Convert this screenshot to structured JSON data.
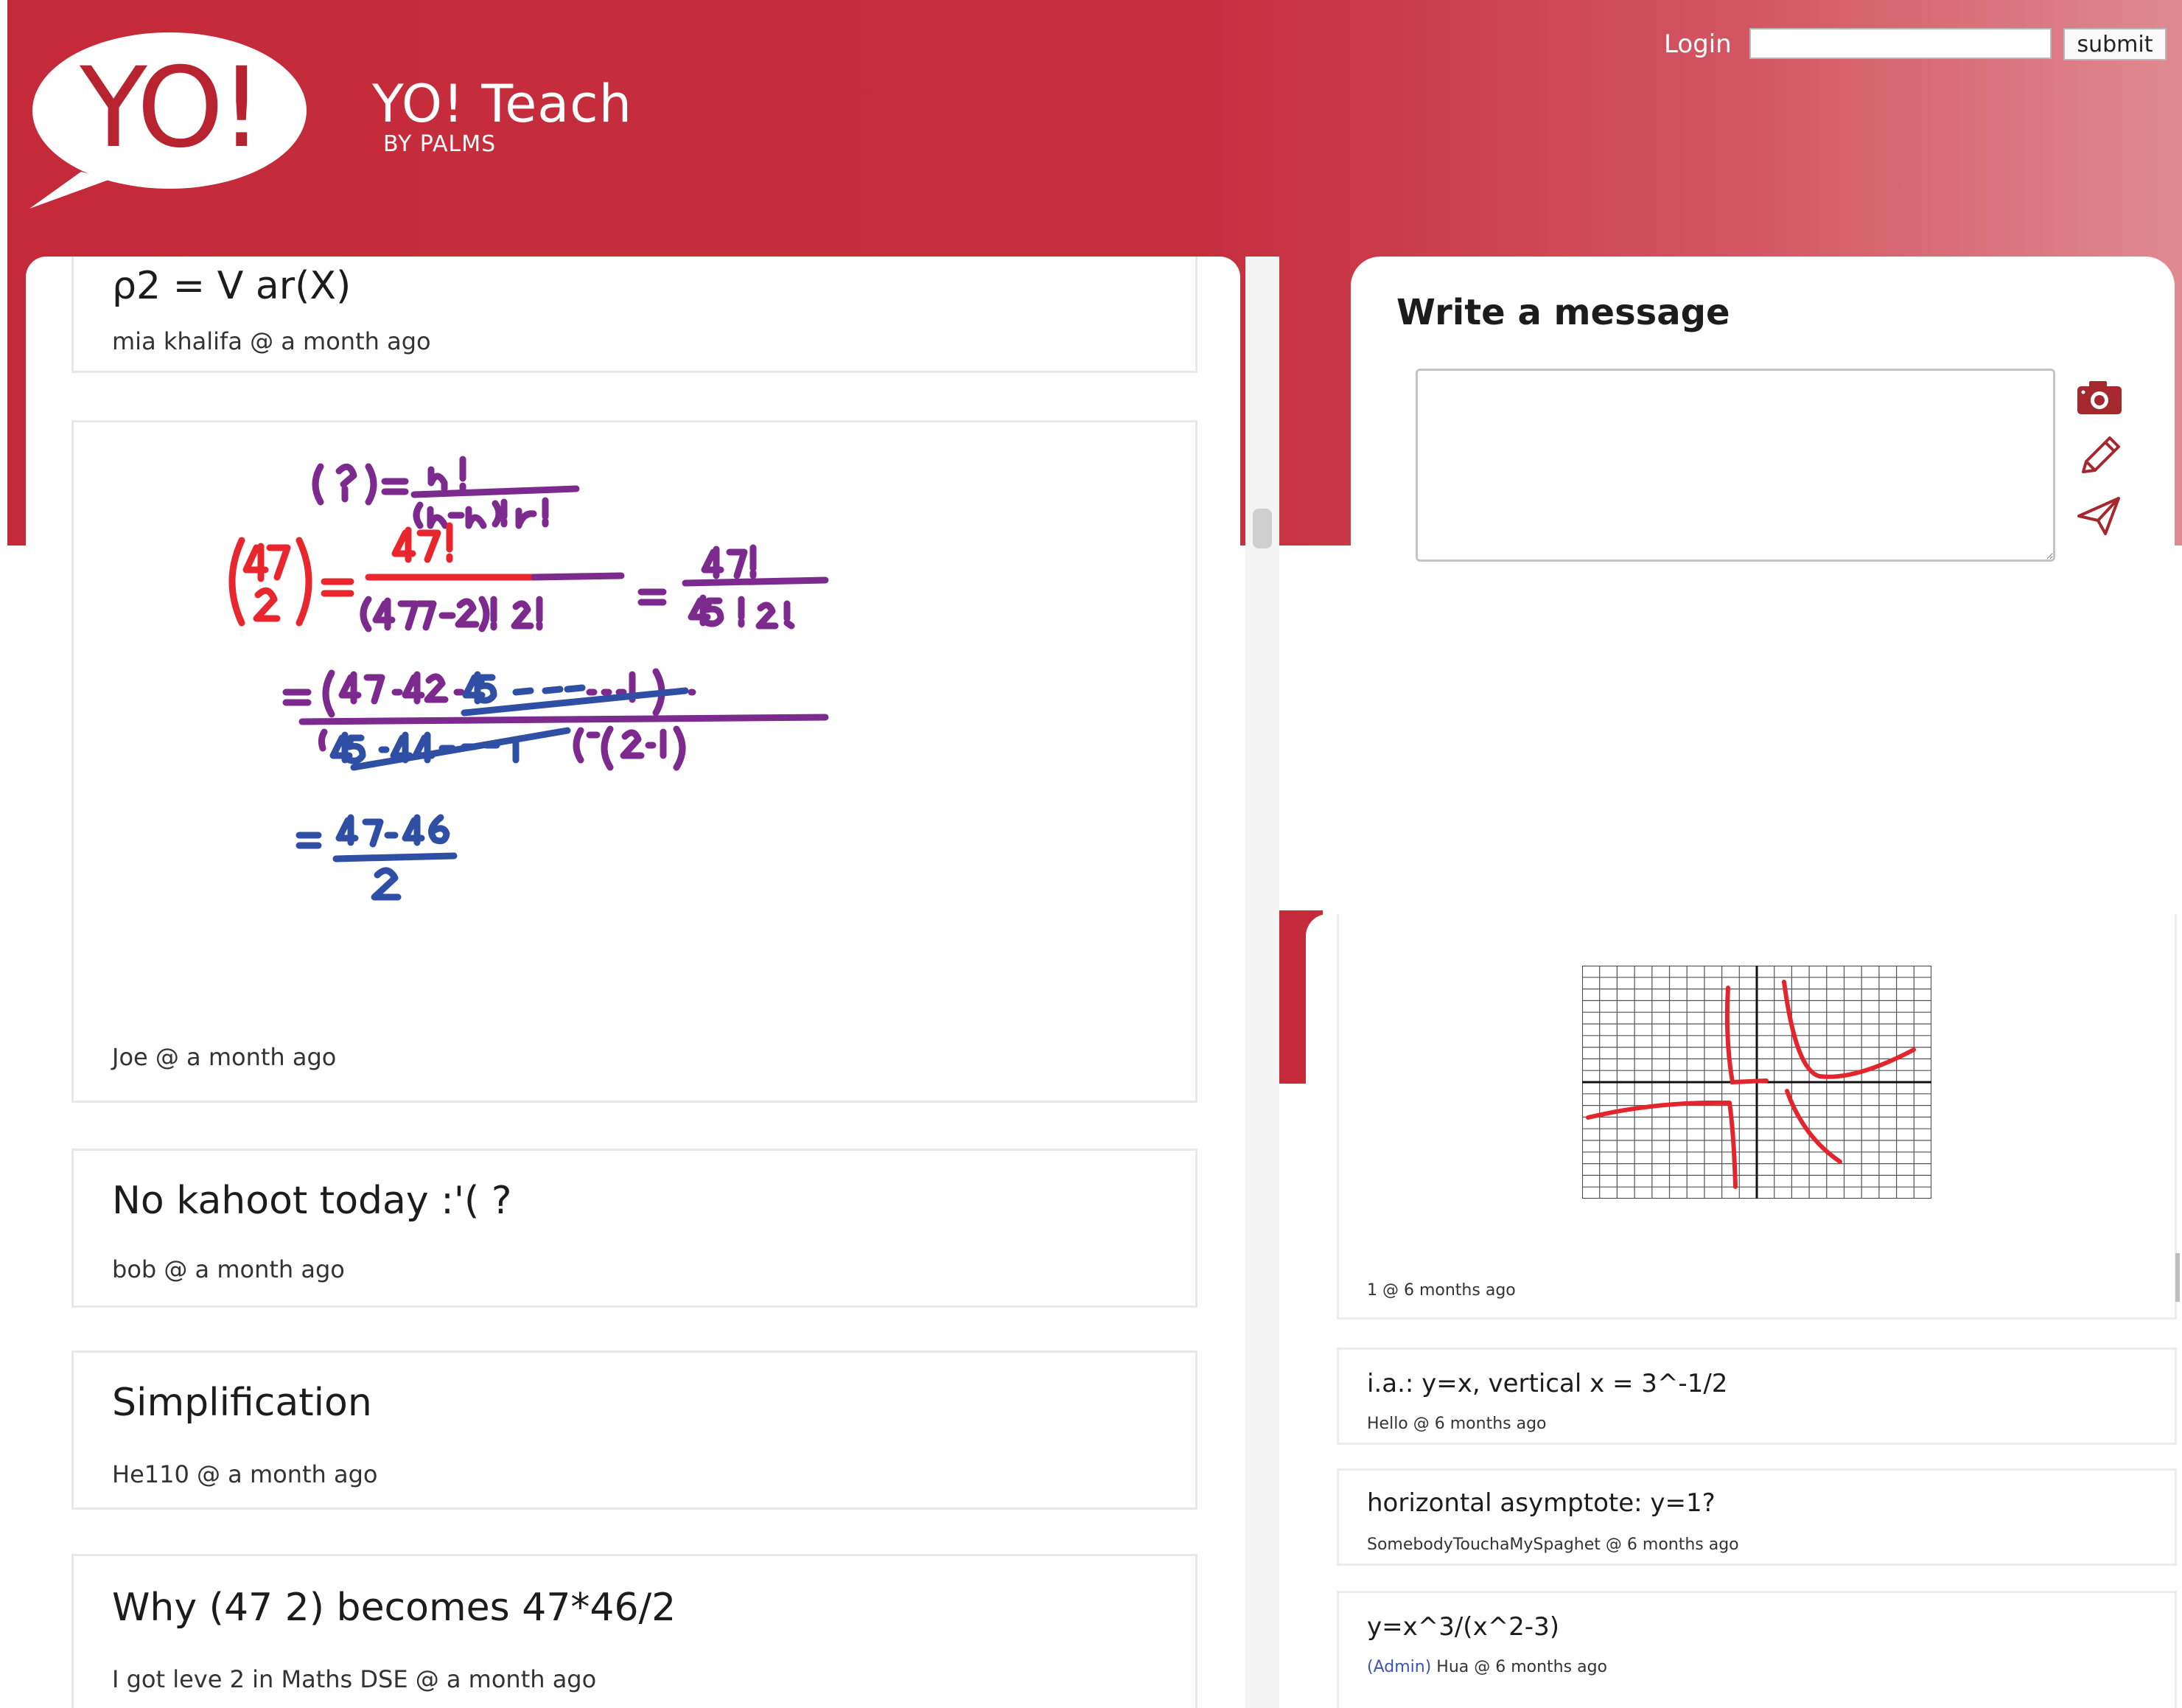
{
  "brand": {
    "logo_text": "YO!",
    "title": "YO! Teach",
    "subtitle": "BY PALMS"
  },
  "header": {
    "login_label": "Login",
    "login_value": "",
    "submit_label": "submit"
  },
  "feed": {
    "posts": [
      {
        "title": "ρ2 = V ar(X)",
        "meta": "mia khalifa @ a month ago"
      },
      {
        "title": "",
        "meta": "Joe @ a month ago",
        "image": "handwritten-combination-working"
      },
      {
        "title": "No kahoot today :'( ?",
        "meta": "bob @ a month ago"
      },
      {
        "title": "Simplification",
        "meta": "He110 @ a month ago"
      },
      {
        "title": "Why (47 2) becomes 47*46/2",
        "meta": "I got leve 2 in Maths DSE @ a month ago"
      }
    ]
  },
  "composer": {
    "heading": "Write a message",
    "text": "",
    "icons": [
      "camera-icon",
      "pencil-icon",
      "send-icon"
    ]
  },
  "right_feed": {
    "posts": [
      {
        "title": "",
        "meta": "1 @ 6 months ago",
        "image": "hyperbola-graph-sketch"
      },
      {
        "title": "i.a.: y=x, vertical x = 3^-1/2",
        "meta": "Hello @ 6 months ago"
      },
      {
        "title": "horizontal asymptote: y=1?",
        "meta": "SomebodyTouchaMySpaghet @ 6 months ago"
      },
      {
        "title": "y=x^3/(x^2-3)",
        "admin_tag": "(Admin)",
        "meta": "Hua @ 6 months ago"
      }
    ]
  },
  "colors": {
    "brand_red": "#c42a3a",
    "icon_red": "#a5282f",
    "admin_blue": "#3b54b0",
    "ink_red": "#e8262d",
    "ink_purple": "#7d2a8f",
    "ink_blue": "#2f4fa5"
  }
}
